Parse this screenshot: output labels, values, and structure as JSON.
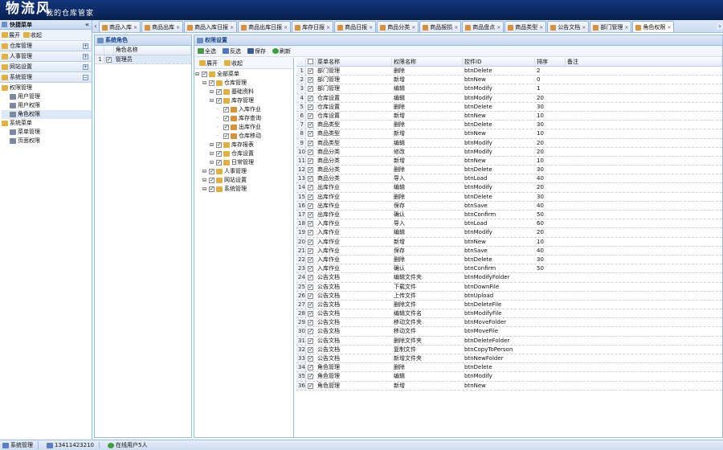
{
  "app": {
    "logo_main": "物流风",
    "logo_sub": "我的仓库管家"
  },
  "left": {
    "title": "快捷菜单",
    "tool": [
      "展开",
      "收起"
    ],
    "accordion": [
      "仓库管理",
      "人事管理",
      "网站设置",
      "系统管理"
    ],
    "tree": [
      {
        "label": "权限管理",
        "level": 0,
        "icon": "folder-icon"
      },
      {
        "label": "用户管理",
        "level": 1,
        "icon": "anchor-icon"
      },
      {
        "label": "用户权限",
        "level": 1,
        "icon": "anchor-icon"
      },
      {
        "label": "角色权限",
        "level": 1,
        "icon": "anchor-icon",
        "selected": true
      },
      {
        "label": "系统菜单",
        "level": 0,
        "icon": "folder-icon"
      },
      {
        "label": "菜单管理",
        "level": 1,
        "icon": "anchor-icon"
      },
      {
        "label": "页面权限",
        "level": 1,
        "icon": "anchor-icon"
      }
    ]
  },
  "tabs": [
    {
      "label": "商品入库"
    },
    {
      "label": "商品出库"
    },
    {
      "label": "商品入库日报"
    },
    {
      "label": "商品出库日报"
    },
    {
      "label": "库存日报"
    },
    {
      "label": "商品日报"
    },
    {
      "label": "商品分类"
    },
    {
      "label": "商品报损"
    },
    {
      "label": "商品盘点"
    },
    {
      "label": "商品类型"
    },
    {
      "label": "公告文档"
    },
    {
      "label": "部门管理"
    },
    {
      "label": "角色权限",
      "active": true
    }
  ],
  "role_panel": {
    "title": "系统角色",
    "col_header": "角色名称",
    "rows": [
      {
        "num": "1",
        "name": "管理员"
      }
    ]
  },
  "perm_panel": {
    "title": "权限设置",
    "tool": [
      "全选",
      "反选",
      "保存",
      "刷新"
    ],
    "tree_tool": [
      "展开",
      "收起"
    ],
    "tree": [
      {
        "label": "全部菜单",
        "level": 0
      },
      {
        "label": "仓库管理",
        "level": 1
      },
      {
        "label": "基础资料",
        "level": 2
      },
      {
        "label": "库存管理",
        "level": 2
      },
      {
        "label": "入库作业",
        "level": 3
      },
      {
        "label": "库存查询",
        "level": 3
      },
      {
        "label": "出库作业",
        "level": 3
      },
      {
        "label": "仓库移动",
        "level": 3
      },
      {
        "label": "库存报表",
        "level": 2
      },
      {
        "label": "仓库设置",
        "level": 2
      },
      {
        "label": "日常管理",
        "level": 2
      },
      {
        "label": "人事管理",
        "level": 1
      },
      {
        "label": "网站设置",
        "level": 1
      },
      {
        "label": "系统管理",
        "level": 1
      }
    ],
    "columns": [
      "菜单名称",
      "权限名称",
      "控件ID",
      "排序",
      "备注"
    ],
    "rows": [
      [
        "部门管理",
        "删除",
        "btnDelete",
        "2"
      ],
      [
        "部门管理",
        "新增",
        "btnNew",
        "0"
      ],
      [
        "部门管理",
        "编辑",
        "btnModify",
        "1"
      ],
      [
        "仓库设置",
        "编辑",
        "btnModify",
        "20"
      ],
      [
        "仓库设置",
        "删除",
        "btnDelete",
        "30"
      ],
      [
        "仓库设置",
        "新增",
        "btnNew",
        "10"
      ],
      [
        "商品类型",
        "删除",
        "btnDelete",
        "30"
      ],
      [
        "商品类型",
        "新增",
        "btnNew",
        "10"
      ],
      [
        "商品类型",
        "编辑",
        "btnModify",
        "20"
      ],
      [
        "商品分类",
        "修改",
        "btnModify",
        "20"
      ],
      [
        "商品分类",
        "新增",
        "btnNew",
        "10"
      ],
      [
        "商品分类",
        "删除",
        "btnDelete",
        "30"
      ],
      [
        "商品分类",
        "导入",
        "btnLoad",
        "40"
      ],
      [
        "出库作业",
        "编辑",
        "btnModify",
        "20"
      ],
      [
        "出库作业",
        "删除",
        "btnDelete",
        "30"
      ],
      [
        "出库作业",
        "保存",
        "btnSave",
        "40"
      ],
      [
        "出库作业",
        "确认",
        "btnConfirm",
        "50"
      ],
      [
        "入库作业",
        "导入",
        "btnLoad",
        "60"
      ],
      [
        "入库作业",
        "编辑",
        "btnModify",
        "20"
      ],
      [
        "入库作业",
        "新增",
        "btnNew",
        "10"
      ],
      [
        "入库作业",
        "保存",
        "btnSave",
        "40"
      ],
      [
        "入库作业",
        "删除",
        "btnDelete",
        "30"
      ],
      [
        "入库作业",
        "确认",
        "btnConfirm",
        "50"
      ],
      [
        "公告文档",
        "编辑文件夹",
        "btnModifyFolder",
        ""
      ],
      [
        "公告文档",
        "下载文件",
        "btnDownFile",
        ""
      ],
      [
        "公告文档",
        "上传文件",
        "btnUpload",
        ""
      ],
      [
        "公告文档",
        "删除文件",
        "btnDeleteFile",
        ""
      ],
      [
        "公告文档",
        "编辑文件名",
        "btnModifyFile",
        ""
      ],
      [
        "公告文档",
        "移动文件夹",
        "btnMoveFolder",
        ""
      ],
      [
        "公告文档",
        "移动文件",
        "btnMoveFile",
        ""
      ],
      [
        "公告文档",
        "删除文件夹",
        "btnDeleteFolder",
        ""
      ],
      [
        "公告文档",
        "复制文件",
        "btnCopyToPerson",
        ""
      ],
      [
        "公告文档",
        "新增文件夹",
        "btnNewFolder",
        ""
      ],
      [
        "角色管理",
        "删除",
        "btnDelete",
        ""
      ],
      [
        "角色管理",
        "编辑",
        "btnModify",
        ""
      ],
      [
        "角色管理",
        "新增",
        "btnNew",
        ""
      ]
    ]
  },
  "status": {
    "user": "系统管理",
    "phone": "13411423210",
    "online": "在线用户5人"
  },
  "colors": {
    "header": "#0a2557",
    "panel_border": "#99bbe8",
    "panel_head": "#c5d7ef"
  }
}
